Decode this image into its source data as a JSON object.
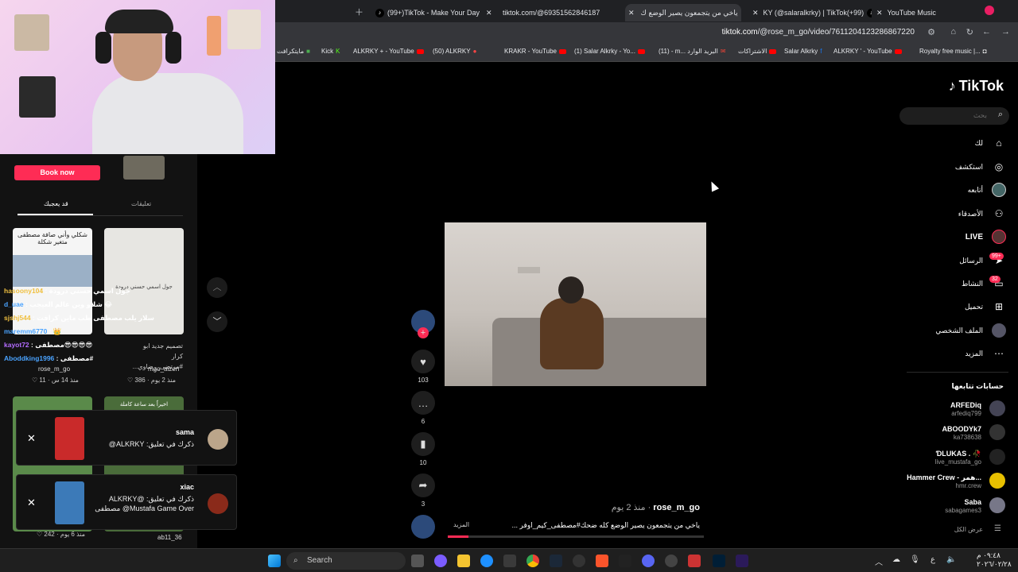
{
  "browser": {
    "tabs": [
      {
        "title": "(99+)TikTok - Make Your Day"
      },
      {
        "title": "tiktok.com/@69351562846187"
      },
      {
        "title": "ياخي من يتجمعون يصير الوضع ك"
      },
      {
        "title": "KY (@salaralkrky) | TikTok(+99)"
      },
      {
        "title": "YouTube Music"
      }
    ],
    "url_domain": "tiktok.com",
    "url_path": "/@rose_m_go/video/7611204123286867220",
    "bookmarks": [
      "مايتكرافت",
      "Kick",
      "ALKRKY + - YouTube",
      "(50) ALKRKY",
      "KRAKR - YouTube",
      "(1) Salar Alkrky - Yo...",
      "(11) - m... البريد الوارد",
      "الاشتراكات",
      "Salar Alkrky",
      "ALKRKY ' - YouTube",
      "Royalty free music |..."
    ]
  },
  "left_panel": {
    "book_now": "Book now",
    "tab_comments": "تعليقات",
    "tab_might_like": "قد يعجبك",
    "cards": [
      {
        "caption": "شكلي وأني صافة مصطفى متغير شكلة",
        "user": "rose_m_go",
        "likes": "11",
        "age": "منذ 14 س"
      },
      {
        "caption": "تصميم جديد ابو كرار #مرتضى_رضاوي...",
        "user": "mgo_aizen",
        "likes": "386",
        "age": "منذ 2 يوم"
      },
      {
        "caption": "",
        "user": "ab11_36",
        "likes": "242",
        "age": "منذ 6 يوم"
      },
      {
        "caption": "اخيراً بعد ساعة كاملة",
        "user": "",
        "likes": "",
        "age": ""
      }
    ],
    "card_overlay_text": "جول اسمي حسني درودة"
  },
  "chat": [
    {
      "user": "hasoony104",
      "msg": "جول اسمي حسني درودة",
      "color": "#f0c040"
    },
    {
      "user": "d_uae",
      "msg": "شلاو وين عالم العيجب 😂",
      "color": "#4aa3ff"
    },
    {
      "user": "sjshj544",
      "msg": "سلار يلب مصطفى طب ماين كرافت",
      "color": "#f0c040"
    },
    {
      "user": "maremm6770",
      "msg": "👑",
      "color": "#4aa3ff"
    },
    {
      "user": "kayot72",
      "msg": "مصطفى😎😎😎😎",
      "color": "#b36cff"
    },
    {
      "user": "Aboddking1996",
      "msg": "مصطفى#",
      "color": "#4aa3ff"
    }
  ],
  "notifications": [
    {
      "name": "sama",
      "text": "ذكرك في تعليق: ALKRKY@"
    },
    {
      "name": "xiac",
      "text": "ذكرك في تعليق: ALKRKY@ Mustafa Game Over@ مصطفى"
    }
  ],
  "video": {
    "likes": "103",
    "comments": "6",
    "saves": "10",
    "shares": "3",
    "author": "rose_m_go",
    "age": "منذ 2 يوم",
    "description": "ياخي من يتجمعون يصير الوضع كله ضحك#مصطفى_كيم_اوفر ...",
    "more": "المزيد"
  },
  "tiktok_nav": {
    "logo": "TikTok",
    "search_placeholder": "بحث",
    "items": [
      {
        "label": "لك",
        "icon": "home-icon"
      },
      {
        "label": "استكشف",
        "icon": "compass-icon"
      },
      {
        "label": "أتابعه",
        "icon": "following-icon"
      },
      {
        "label": "الأصدقاء",
        "icon": "friends-icon"
      },
      {
        "label": "LIVE",
        "icon": "live-icon"
      },
      {
        "label": "الرسائل",
        "icon": "messages-icon",
        "badge": "99+"
      },
      {
        "label": "النشاط",
        "icon": "activity-icon",
        "badge": "32"
      },
      {
        "label": "تحميل",
        "icon": "upload-icon"
      },
      {
        "label": "الملف الشخصي",
        "icon": "profile-icon"
      },
      {
        "label": "المزيد",
        "icon": "more-icon"
      }
    ],
    "following_title": "حسابات تتابعها",
    "following": [
      {
        "name": "ARFEDiq",
        "handle": "arfediq799"
      },
      {
        "name": "ABOODYk7",
        "handle": "ka738638"
      },
      {
        "name": "ƊLUKAS . 🥀",
        "handle": "live_mustafa_go"
      },
      {
        "name": "Hammer Crew - همر...",
        "handle": "hmr.crew"
      },
      {
        "name": "Saba",
        "handle": "sabagames3"
      }
    ],
    "see_all": "عرض الكل"
  },
  "taskbar": {
    "search": "Search",
    "time": "٠٩:٤٨ م",
    "date": "٢٠٢٦/٠٢/٢٨",
    "lang": "ع"
  }
}
